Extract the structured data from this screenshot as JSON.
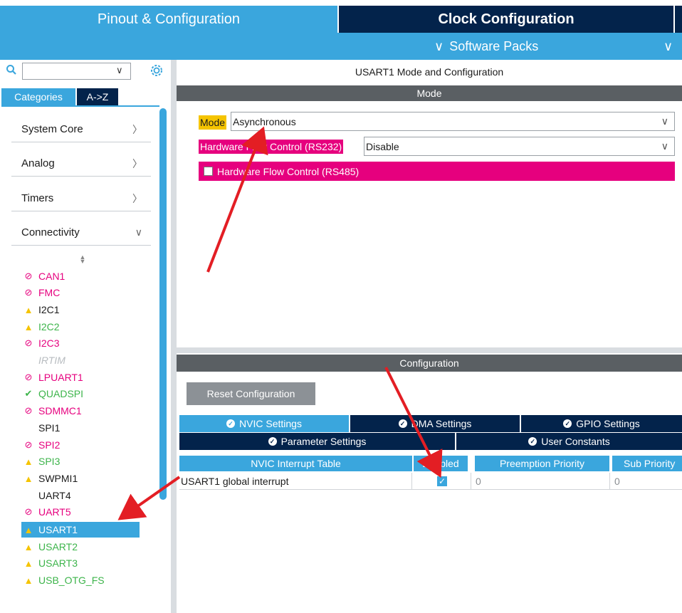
{
  "top_tabs": {
    "pinout": "Pinout & Configuration",
    "clock": "Clock Configuration",
    "software_packs": "Software Packs"
  },
  "left": {
    "search_placeholder": "",
    "tabs": {
      "categories": "Categories",
      "az": "A->Z"
    },
    "categories": [
      {
        "label": "System Core",
        "chevron": "right"
      },
      {
        "label": "Analog",
        "chevron": "right"
      },
      {
        "label": "Timers",
        "chevron": "right"
      },
      {
        "label": "Connectivity",
        "chevron": "down"
      }
    ],
    "peripherals": [
      {
        "label": "CAN1",
        "status": "blocked",
        "color": "#e6007e"
      },
      {
        "label": "FMC",
        "status": "blocked",
        "color": "#e6007e"
      },
      {
        "label": "I2C1",
        "status": "warning",
        "color": "#1b1b1b"
      },
      {
        "label": "I2C2",
        "status": "warning",
        "color": "#3cb44a"
      },
      {
        "label": "I2C3",
        "status": "blocked",
        "color": "#e6007e"
      },
      {
        "label": "IRTIM",
        "status": "disabled",
        "color": "#b8bcc0"
      },
      {
        "label": "LPUART1",
        "status": "blocked",
        "color": "#e6007e"
      },
      {
        "label": "QUADSPI",
        "status": "ok",
        "color": "#3cb44a"
      },
      {
        "label": "SDMMC1",
        "status": "blocked",
        "color": "#e6007e"
      },
      {
        "label": "SPI1",
        "status": "none",
        "color": "#1b1b1b"
      },
      {
        "label": "SPI2",
        "status": "blocked",
        "color": "#e6007e"
      },
      {
        "label": "SPI3",
        "status": "warning",
        "color": "#3cb44a"
      },
      {
        "label": "SWPMI1",
        "status": "warning",
        "color": "#1b1b1b"
      },
      {
        "label": "UART4",
        "status": "none",
        "color": "#1b1b1b"
      },
      {
        "label": "UART5",
        "status": "blocked",
        "color": "#e6007e"
      },
      {
        "label": "USART1",
        "status": "warning",
        "color": "#ffffff",
        "selected": true
      },
      {
        "label": "USART2",
        "status": "warning",
        "color": "#3cb44a"
      },
      {
        "label": "USART3",
        "status": "warning",
        "color": "#3cb44a"
      },
      {
        "label": "USB_OTG_FS",
        "status": "warning",
        "color": "#3cb44a"
      }
    ]
  },
  "right": {
    "title": "USART1 Mode and Configuration",
    "mode_header": "Mode",
    "mode": {
      "label": "Mode",
      "value": "Asynchronous"
    },
    "hfc_rs232": {
      "label": "Hardware Flow Control (RS232)",
      "value": "Disable"
    },
    "hfc_rs485": {
      "label": "Hardware Flow Control (RS485)",
      "checked": false
    },
    "config_header": "Configuration",
    "reset_button": "Reset Configuration",
    "tabs_row1": [
      "NVIC Settings",
      "DMA Settings",
      "GPIO Settings"
    ],
    "tabs_row2": [
      "Parameter Settings",
      "User Constants"
    ],
    "table": {
      "headers": [
        "NVIC Interrupt Table",
        "Enabled",
        "Preemption Priority",
        "Sub Priority"
      ],
      "rows": [
        {
          "name": "USART1 global interrupt",
          "enabled": true,
          "preemption": "0",
          "sub": "0"
        }
      ]
    }
  },
  "colors": {
    "accent_blue": "#3aa6dd",
    "navy": "#03234b",
    "pink": "#e6007e",
    "yellow": "#f5c400",
    "arrow_red": "#e31e24"
  }
}
